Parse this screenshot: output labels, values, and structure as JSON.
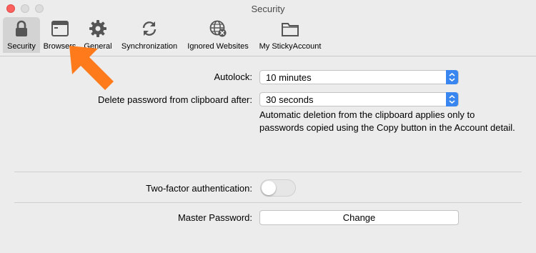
{
  "window": {
    "title": "Security"
  },
  "toolbar": {
    "items": [
      {
        "label": "Security",
        "icon": "lock-icon",
        "selected": true
      },
      {
        "label": "Browsers",
        "icon": "browser-window-icon"
      },
      {
        "label": "General",
        "icon": "gear-icon"
      },
      {
        "label": "Synchronization",
        "icon": "sync-icon"
      },
      {
        "label": "Ignored Websites",
        "icon": "globe-blocked-icon"
      },
      {
        "label": "My StickyAccount",
        "icon": "folder-icon"
      }
    ]
  },
  "settings": {
    "autolock": {
      "label": "Autolock:",
      "value": "10 minutes"
    },
    "clipboard": {
      "label": "Delete password from clipboard after:",
      "value": "30 seconds",
      "hint": "Automatic deletion from the clipboard applies only to passwords copied using the Copy button in the Account detail."
    },
    "two_factor": {
      "label": "Two-factor authentication:",
      "enabled": false
    },
    "master_password": {
      "label": "Master Password:",
      "button_label": "Change"
    }
  },
  "colors": {
    "accent": "#3a86f0",
    "annotation_arrow": "#ff7a1a",
    "close_button": "#fc605c"
  }
}
